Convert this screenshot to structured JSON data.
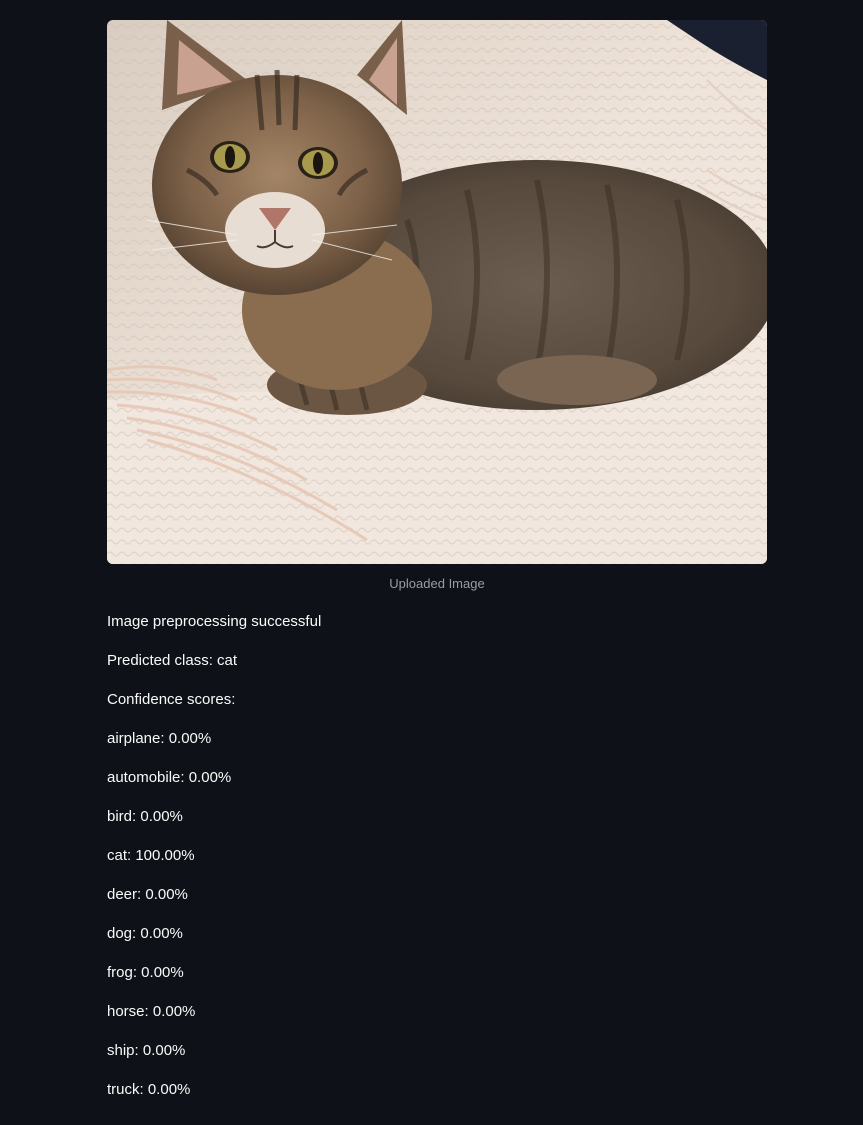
{
  "image": {
    "caption": "Uploaded Image",
    "subject": "tabby kitten lying on a cream knitted blanket with fringe"
  },
  "status": {
    "message": "Image preprocessing successful"
  },
  "prediction": {
    "label": "Predicted class: cat"
  },
  "confidence": {
    "heading": "Confidence scores:",
    "items": [
      {
        "text": "airplane: 0.00%"
      },
      {
        "text": "automobile: 0.00%"
      },
      {
        "text": "bird: 0.00%"
      },
      {
        "text": "cat: 100.00%"
      },
      {
        "text": "deer: 0.00%"
      },
      {
        "text": "dog: 0.00%"
      },
      {
        "text": "frog: 0.00%"
      },
      {
        "text": "horse: 0.00%"
      },
      {
        "text": "ship: 0.00%"
      },
      {
        "text": "truck: 0.00%"
      }
    ]
  },
  "colors": {
    "background": "#0e1117",
    "text": "#fafafa",
    "caption": "#9a9ca3"
  }
}
